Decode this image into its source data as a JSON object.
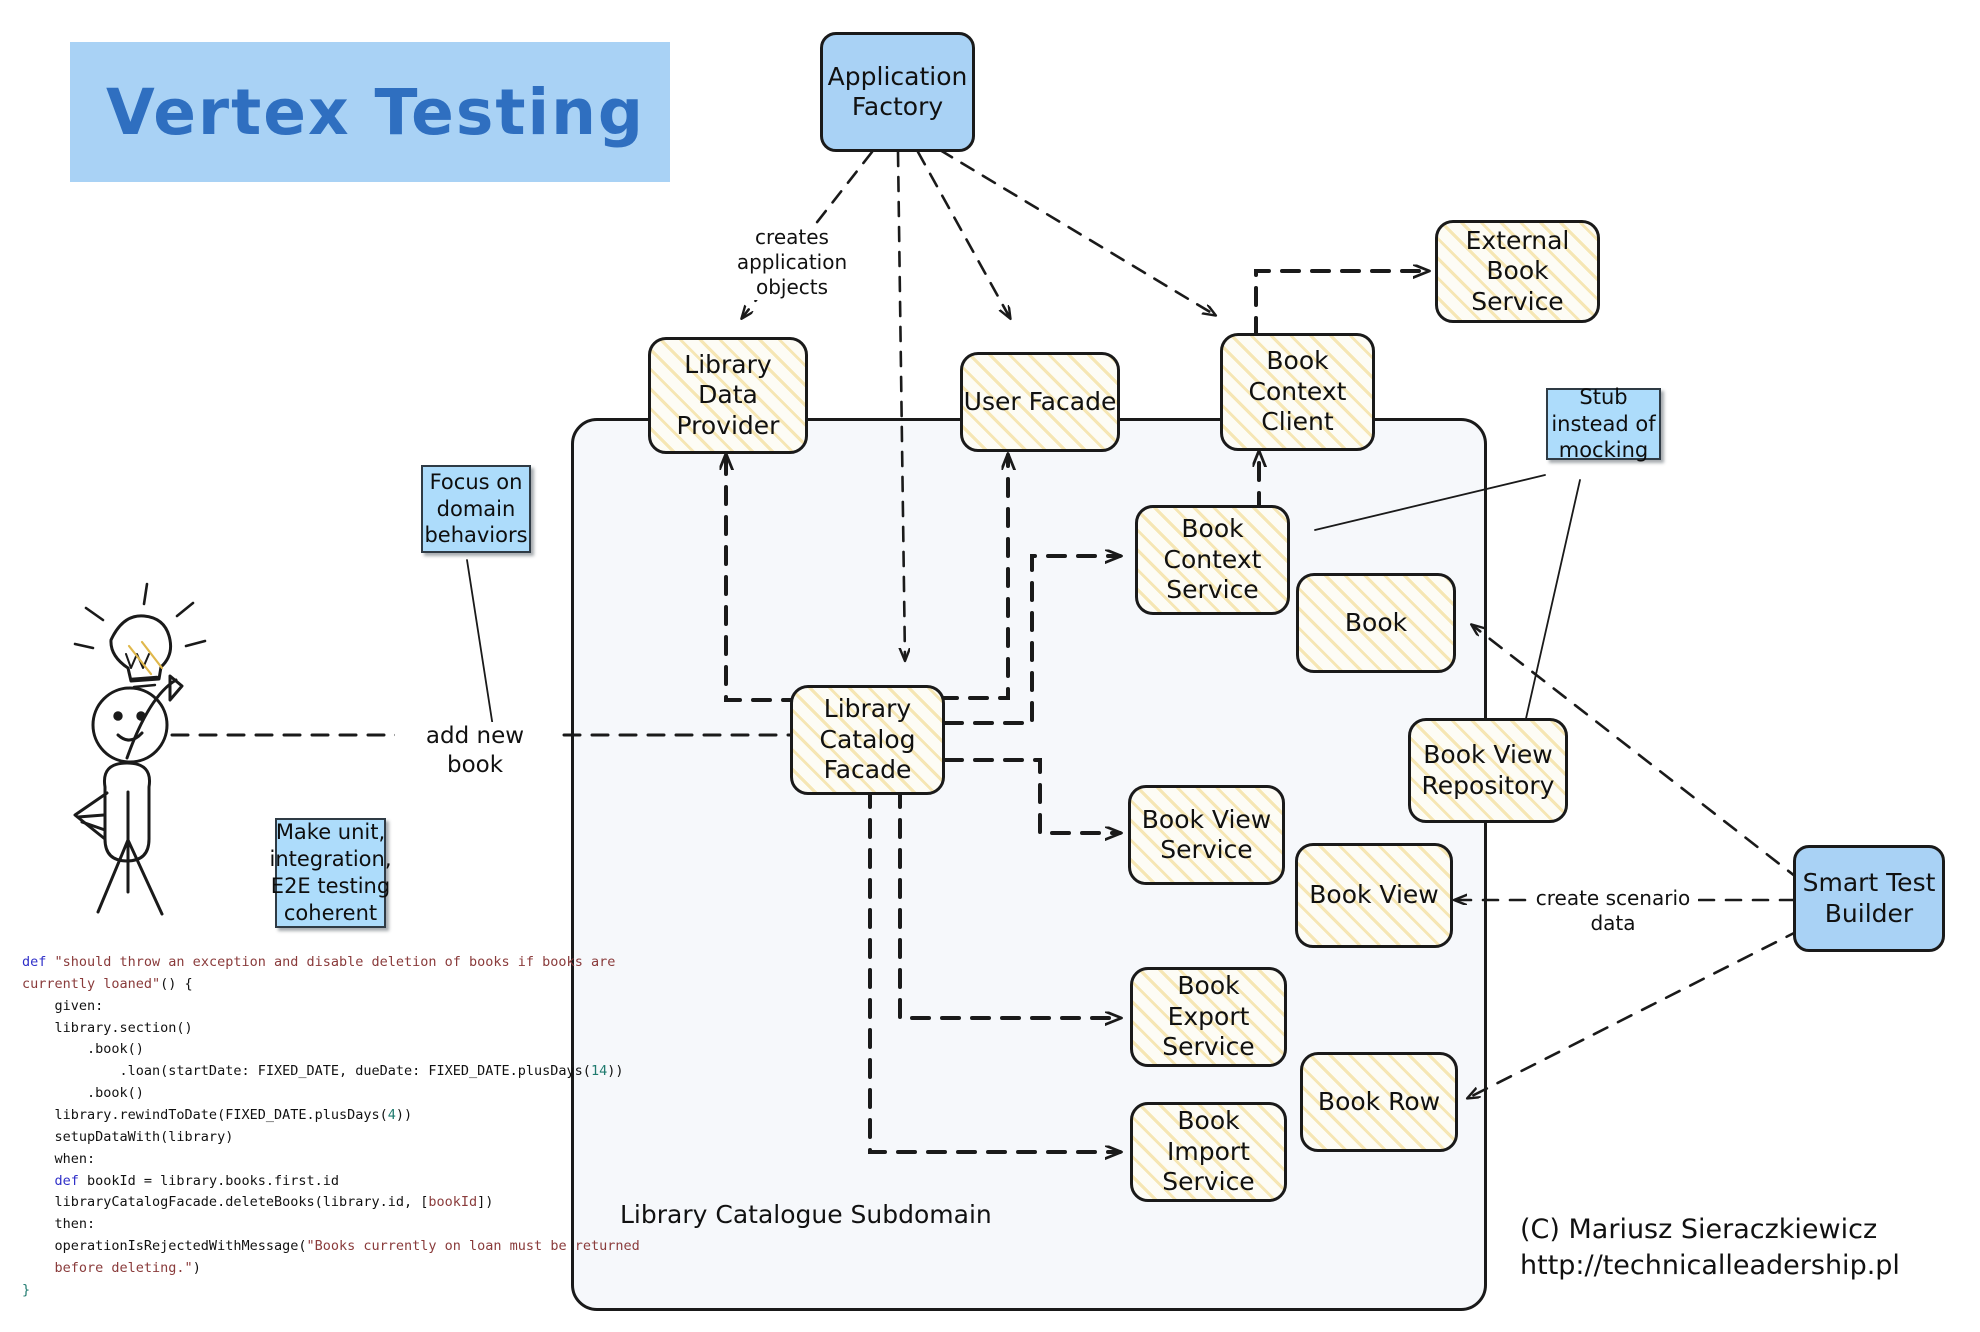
{
  "title": {
    "text": "Vertex Testing"
  },
  "boundary": {
    "label": "Library Catalogue Subdomain"
  },
  "credit": {
    "line1": "(C) Mariusz Sieraczkiewicz",
    "line2": "http://technicalleadership.pl"
  },
  "nodes": {
    "application_factory": "Application Factory",
    "library_data_provider": "Library Data Provider",
    "user_facade": "User Facade",
    "book_context_client": "Book Context Client",
    "external_book_service": "External Book Service",
    "book_context_service": "Book Context Service",
    "library_catalog_facade": "Library Catalog Facade",
    "book": "Book",
    "book_view_repository": "Book View Repository",
    "book_view_service": "Book View Service",
    "book_view": "Book View",
    "book_export_service": "Book Export Service",
    "book_row": "Book Row",
    "book_import_service": "Book Import Service",
    "smart_test_builder": "Smart Test Builder"
  },
  "notes": {
    "focus": "Focus on domain behaviors",
    "coherent": "Make unit, integration, E2E testing coherent",
    "stub": "Stub instead of mocking"
  },
  "edge_labels": {
    "creates_application_objects": "creates application objects",
    "add_new_book": "add new book",
    "create_scenario_data": "create scenario data"
  },
  "code": {
    "lines": [
      [
        [
          "k",
          "def "
        ],
        [
          "s",
          "\"should throw an exception and disable deletion of books if books are"
        ]
      ],
      [
        [
          "s",
          "currently loaned\""
        ],
        [
          "p",
          "() {"
        ]
      ],
      [
        [
          "p",
          "    given:"
        ]
      ],
      [
        [
          "p",
          "    library.section()"
        ]
      ],
      [
        [
          "p",
          "        .book()"
        ]
      ],
      [
        [
          "p",
          "            .loan(startDate: FIXED_DATE, dueDate: FIXED_DATE.plusDays("
        ],
        [
          "n",
          "14"
        ],
        [
          "p",
          "))"
        ]
      ],
      [
        [
          "p",
          "        .book()"
        ]
      ],
      [
        [
          "p",
          ""
        ]
      ],
      [
        [
          "p",
          "    library.rewindToDate(FIXED_DATE.plusDays("
        ],
        [
          "n",
          "4"
        ],
        [
          "p",
          "))"
        ]
      ],
      [
        [
          "p",
          "    setupDataWith(library)"
        ]
      ],
      [
        [
          "p",
          ""
        ]
      ],
      [
        [
          "p",
          "    when:"
        ]
      ],
      [
        [
          "k",
          "    def "
        ],
        [
          "p",
          "bookId = library.books.first.id"
        ]
      ],
      [
        [
          "p",
          "    libraryCatalogFacade.deleteBooks(library.id, ["
        ],
        [
          "s",
          "bookId"
        ],
        [
          "p",
          "])"
        ]
      ],
      [
        [
          "p",
          ""
        ]
      ],
      [
        [
          "p",
          "    then:"
        ]
      ],
      [
        [
          "p",
          "    operationIsRejectedWithMessage("
        ],
        [
          "s",
          "\"Books currently on loan must be returned"
        ]
      ],
      [
        [
          "s",
          "    before deleting.\""
        ],
        [
          "p",
          ")"
        ]
      ],
      [
        [
          "n",
          "}"
        ]
      ]
    ]
  },
  "colors": {
    "accent_blue": "#a9d2f5",
    "note_blue": "#addcfb",
    "title_text": "#2f6fc0",
    "node_yellow": "#fdfcf5",
    "hatch": "#ebc85a",
    "stroke": "#1a1a1a",
    "boundary_fill": "#f6f8fb"
  }
}
